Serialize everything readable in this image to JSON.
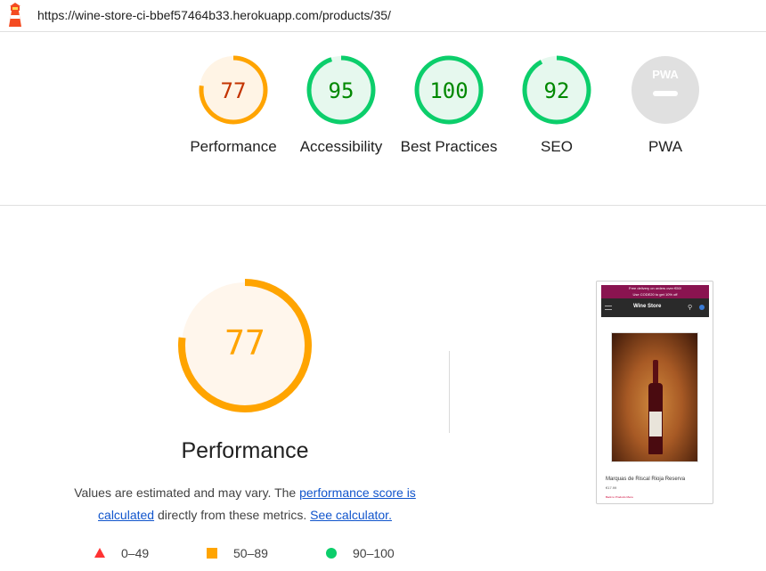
{
  "header": {
    "url": "https://wine-store-ci-bbef57464b33.herokuapp.com/products/35/"
  },
  "colors": {
    "pass": "#0cce6b",
    "average": "#ffa400",
    "fail": "#ff3333",
    "na": "#e0e0e0"
  },
  "scores": [
    {
      "name": "performance",
      "label": "Performance",
      "value": "77",
      "score": 77,
      "rating": "average"
    },
    {
      "name": "accessibility",
      "label": "Accessibility",
      "value": "95",
      "score": 95,
      "rating": "pass"
    },
    {
      "name": "best-practices",
      "label": "Best Practices",
      "value": "100",
      "score": 100,
      "rating": "pass"
    },
    {
      "name": "seo",
      "label": "SEO",
      "value": "92",
      "score": 92,
      "rating": "pass"
    },
    {
      "name": "pwa",
      "label": "PWA",
      "value": "PWA",
      "score": null,
      "rating": "na"
    }
  ],
  "main": {
    "score": "77",
    "score_value": 77,
    "title": "Performance",
    "desc_prefix": "Values are estimated and may vary. The ",
    "link_score": "performance score is calculated",
    "desc_middle": " directly from these metrics. ",
    "link_calculator": "See calculator."
  },
  "legend": [
    {
      "shape": "triangle",
      "range": "0–49"
    },
    {
      "shape": "square",
      "range": "50–89"
    },
    {
      "shape": "circle",
      "range": "90–100"
    }
  ],
  "thumbnail": {
    "banner_line1": "Free delivery on orders over €50!",
    "banner_line2": "Use CODE20 to get 10% off",
    "brand": "Wine Store",
    "product_name": "Marquas de Riscal Rioja Reserva",
    "price": "€17.99",
    "back_link": "Back to Products Menu"
  }
}
